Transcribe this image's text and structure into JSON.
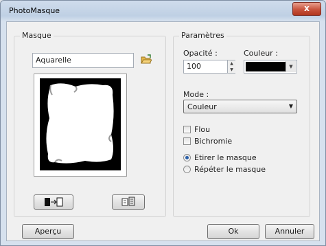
{
  "window": {
    "title": "PhotoMasque",
    "close_glyph": "x"
  },
  "masque": {
    "group_label": "Masque",
    "name_value": "Aquarelle",
    "folder_icon": "folder-open-icon",
    "btn1_icon": "swap-mask-icon",
    "btn2_icon": "mask-settings-icon"
  },
  "params": {
    "group_label": "Paramètres",
    "opacity_label": "Opacité :",
    "opacity_value": "100",
    "color_label": "Couleur :",
    "color_value": "#000000",
    "mode_label": "Mode :",
    "mode_value": "Couleur",
    "flou_label": "Flou",
    "flou_checked": false,
    "bichromie_label": "Bichromie",
    "bichromie_checked": false,
    "etirer_label": "Etirer le masque",
    "etirer_checked": true,
    "repeter_label": "Répéter le masque",
    "repeter_checked": false
  },
  "footer": {
    "preview_label": "Aperçu",
    "ok_label": "Ok",
    "cancel_label": "Annuler"
  }
}
